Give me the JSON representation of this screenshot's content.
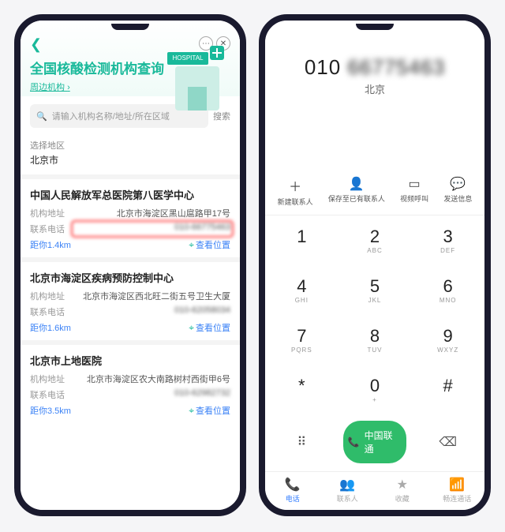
{
  "left": {
    "title": "全国核酸检测机构查询",
    "subtitle": "周边机构",
    "sign": "HOSPITAL",
    "search_placeholder": "请输入机构名称/地址/所在区域",
    "search_btn": "搜索",
    "region_label": "选择地区",
    "region_value": "北京市",
    "field_addr": "机构地址",
    "field_tel": "联系电话",
    "view_loc": "查看位置",
    "institutions": [
      {
        "name": "中国人民解放军总医院第八医学中心",
        "addr": "北京市海淀区黑山扈路甲17号",
        "tel": "010-66775463",
        "dist": "距你1.4km",
        "hl": true
      },
      {
        "name": "北京市海淀区疾病预防控制中心",
        "addr": "北京市海淀区西北旺二街五号卫生大厦",
        "tel": "010-62058034",
        "dist": "距你1.6km",
        "hl": false
      },
      {
        "name": "北京市上地医院",
        "addr": "北京市海淀区农大南路树村西街甲6号",
        "tel": "010-62982732",
        "dist": "距你3.5km",
        "hl": false
      }
    ]
  },
  "right": {
    "dialed_prefix": "010",
    "dialed_rest": "66775463",
    "dialed_city": "北京",
    "actions": [
      {
        "icon": "+",
        "label": "新建联系人"
      },
      {
        "icon": "person",
        "label": "保存至已有联系人"
      },
      {
        "icon": "video",
        "label": "视频呼叫"
      },
      {
        "icon": "msg",
        "label": "发送信息"
      }
    ],
    "keys": [
      {
        "d": "1",
        "s": ""
      },
      {
        "d": "2",
        "s": "ABC"
      },
      {
        "d": "3",
        "s": "DEF"
      },
      {
        "d": "4",
        "s": "GHI"
      },
      {
        "d": "5",
        "s": "JKL"
      },
      {
        "d": "6",
        "s": "MNO"
      },
      {
        "d": "7",
        "s": "PQRS"
      },
      {
        "d": "8",
        "s": "TUV"
      },
      {
        "d": "9",
        "s": "WXYZ"
      },
      {
        "d": "*",
        "s": ""
      },
      {
        "d": "0",
        "s": "+"
      },
      {
        "d": "#",
        "s": ""
      }
    ],
    "call_label": "中国联通",
    "tabs": [
      {
        "label": "电话",
        "active": true
      },
      {
        "label": "联系人",
        "active": false
      },
      {
        "label": "收藏",
        "active": false
      },
      {
        "label": "畅连通话",
        "active": false
      }
    ]
  }
}
